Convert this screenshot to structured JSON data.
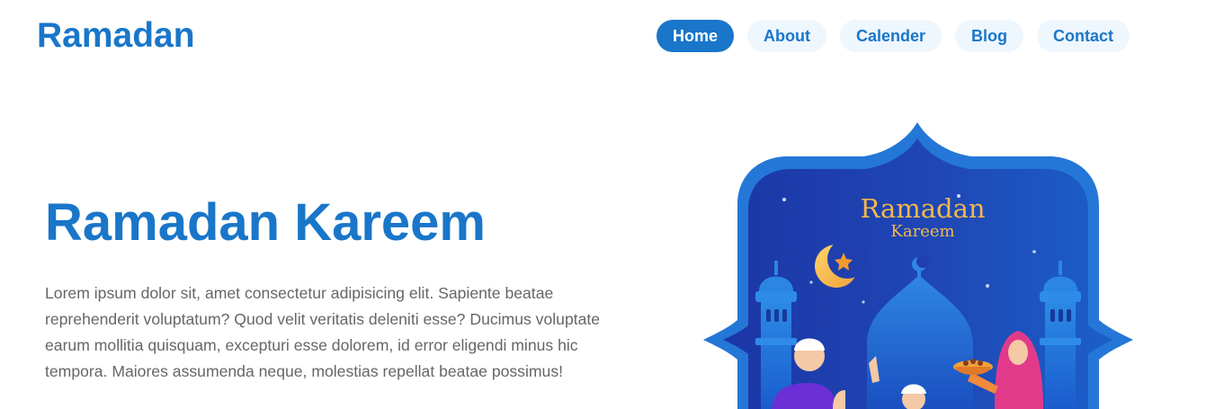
{
  "header": {
    "logo": "Ramadan",
    "nav": [
      {
        "label": "Home",
        "active": true
      },
      {
        "label": "About",
        "active": false
      },
      {
        "label": "Calender",
        "active": false
      },
      {
        "label": "Blog",
        "active": false
      },
      {
        "label": "Contact",
        "active": false
      }
    ]
  },
  "hero": {
    "title": "Ramadan Kareem",
    "text": "Lorem ipsum dolor sit, amet consectetur adipisicing elit. Sapiente beatae reprehenderit voluptatum? Quod velit veritatis deleniti esse? Ducimus voluptate earum mollitia quisquam, excepturi esse dolorem, id error eligendi minus hic tempora. Maiores assumenda neque, molestias repellat beatae possimus!"
  },
  "illustration": {
    "title_line1": "Ramadan",
    "title_line2": "Kareem"
  },
  "colors": {
    "brand": "#1976c9",
    "nav_bg": "#eef6fe",
    "body_text": "#666666",
    "art_dark": "#1e3aa8",
    "art_frame": "#2477d6",
    "gold": "#f2b84b"
  }
}
